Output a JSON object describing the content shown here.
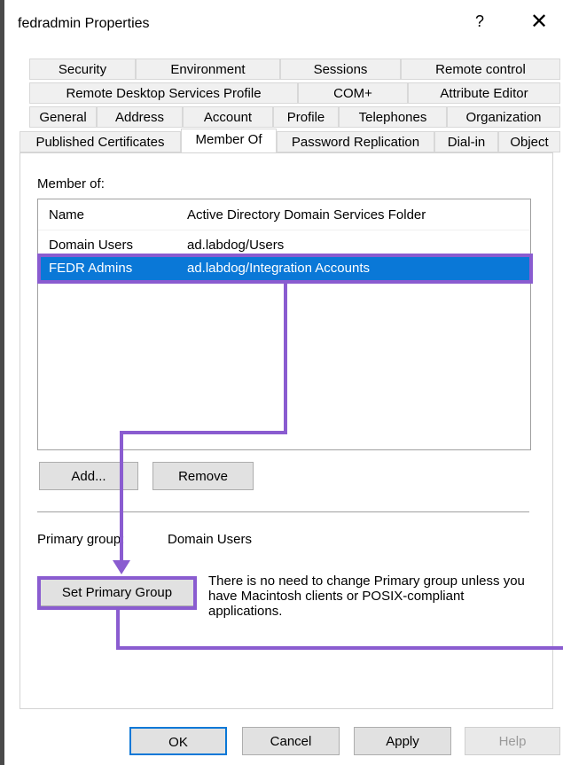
{
  "window": {
    "title": "fedradmin Properties",
    "help_glyph": "?",
    "close_glyph": "✕"
  },
  "tabs": [
    "Security",
    "Environment",
    "Sessions",
    "Remote control",
    "Remote Desktop Services Profile",
    "COM+",
    "Attribute Editor",
    "General",
    "Address",
    "Account",
    "Profile",
    "Telephones",
    "Organization",
    "Published Certificates",
    "Member Of",
    "Password Replication",
    "Dial-in",
    "Object"
  ],
  "active_tab": "Member Of",
  "member_of": {
    "label": "Member of:",
    "columns": [
      "Name",
      "Active Directory Domain Services Folder"
    ],
    "rows": [
      {
        "name": "Domain Users",
        "folder": "ad.labdog/Users"
      },
      {
        "name": "FEDR Admins",
        "folder": "ad.labdog/Integration Accounts"
      }
    ],
    "selected_row": "FEDR Admins"
  },
  "buttons": {
    "add": "Add...",
    "remove": "Remove",
    "set_primary_group": "Set Primary Group",
    "ok": "OK",
    "cancel": "Cancel",
    "apply": "Apply",
    "help": "Help"
  },
  "primary_group": {
    "label": "Primary group:",
    "value": "Domain Users"
  },
  "note": "There is no need to change Primary group unless you have Macintosh clients or POSIX-compliant applications.",
  "colors": {
    "selection": "#0a78d7",
    "annotation": "#8a5cd0"
  }
}
